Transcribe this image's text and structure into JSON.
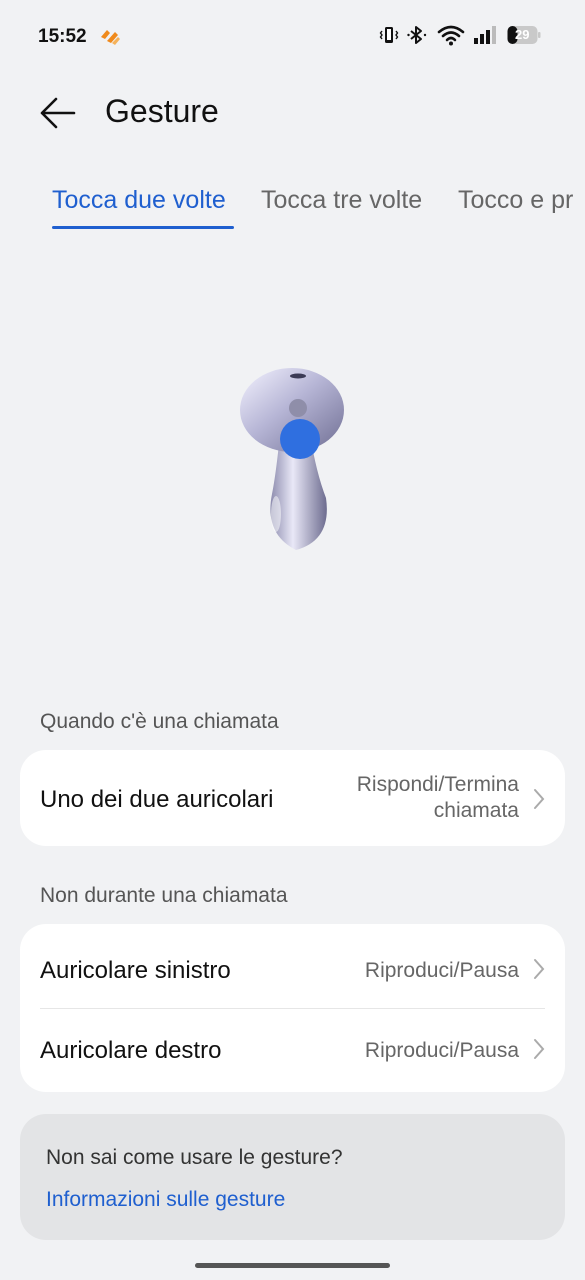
{
  "status_bar": {
    "time": "15:52",
    "battery": "29",
    "icons": [
      "vibrate-icon",
      "bluetooth-icon",
      "wifi-icon",
      "signal-icon",
      "battery-icon"
    ]
  },
  "header": {
    "title": "Gesture"
  },
  "tabs": [
    {
      "label": "Tocca due volte",
      "active": true
    },
    {
      "label": "Tocca tre volte",
      "active": false
    },
    {
      "label": "Tocco e pr",
      "active": false
    }
  ],
  "sections": {
    "call": {
      "label": "Quando c'è una chiamata",
      "rows": [
        {
          "label": "Uno dei due auricolari",
          "value_line1": "Rispondi/Termina",
          "value_line2": "chiamata"
        }
      ]
    },
    "no_call": {
      "label": "Non durante una chiamata",
      "rows": [
        {
          "label": "Auricolare sinistro",
          "value": "Riproduci/Pausa"
        },
        {
          "label": "Auricolare destro",
          "value": "Riproduci/Pausa"
        }
      ]
    }
  },
  "help": {
    "question": "Non sai come usare le gesture?",
    "link": "Informazioni sulle gesture"
  },
  "colors": {
    "accent": "#1f5fcf",
    "background": "#f1f2f4",
    "card": "#ffffff"
  }
}
